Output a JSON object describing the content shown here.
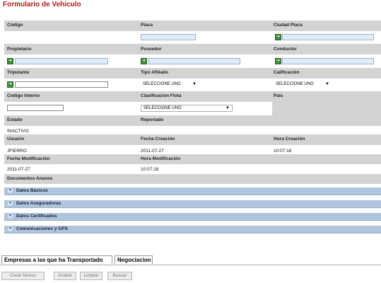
{
  "form": {
    "title": "Formulario de Vehiculo"
  },
  "fields": {
    "codigo": {
      "label": "Código"
    },
    "placa": {
      "label": "Placa",
      "value": ""
    },
    "ciudad_placa": {
      "label": "Ciudad Placa",
      "value": ""
    },
    "propietario": {
      "label": "Propietario",
      "value": ""
    },
    "poseedor": {
      "label": "Poseedor",
      "value": ""
    },
    "conductor": {
      "label": "Conductor",
      "value": ""
    },
    "tripulante": {
      "label": "Tripulante",
      "value": ""
    },
    "tipo_afiliado": {
      "label": "Tipo Afiliado",
      "selected": "SELECCIONE UNO"
    },
    "calificacion": {
      "label": "Calificación",
      "selected": "SELECCIONE UNO"
    },
    "codigo_interno": {
      "label": "Codigo Interno",
      "value": ""
    },
    "clasificacion_flota": {
      "label": "Clasificacion Flota",
      "selected": "SELECCIONE UNO"
    },
    "pais": {
      "label": "Pais"
    },
    "estado": {
      "label": "Estado",
      "value": "INACTIVO"
    },
    "reportado": {
      "label": "Reportado"
    },
    "usuario": {
      "label": "Usuario",
      "value": "JFIERRO"
    },
    "fecha_creacion": {
      "label": "Fecha Creación",
      "value": "2011-07-27"
    },
    "hora_creacion": {
      "label": "Hora Creación",
      "value": "10:07:18"
    },
    "fecha_modificacion": {
      "label": "Fecha Modificación",
      "value": "2011-07-27"
    },
    "hora_modificacion": {
      "label": "Hora Modificación",
      "value": "10:07:18"
    },
    "documentos_anexos": {
      "label": "Documentos Anexos"
    }
  },
  "sections": [
    {
      "title": "Datos Básicos"
    },
    {
      "title": "Datos Aseguradoras"
    },
    {
      "title": "Datos Certificados"
    },
    {
      "title": "Comunicaciones y GPS"
    }
  ],
  "tabs": [
    {
      "label": "Empresas a las que ha Transportado"
    },
    {
      "label": "Negociacion"
    }
  ],
  "buttons": {
    "crear_nuevo": "Crear Nuevo",
    "grabar": "Grabar",
    "limpiar": "Limpiar",
    "buscar": "Buscar"
  },
  "icons": {
    "lookup": "lookup-icon",
    "toggle": "expand-icon",
    "dropdown": "chevron-down-icon"
  }
}
